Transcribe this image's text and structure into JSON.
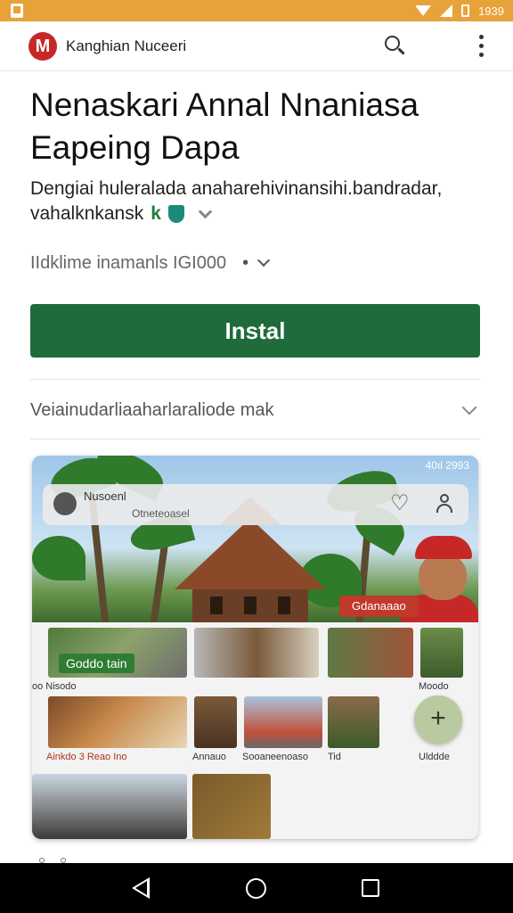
{
  "status_bar": {
    "time": "1939"
  },
  "app_bar": {
    "logo_letter": "M",
    "app_name": "Kanghian Nuceeri"
  },
  "listing": {
    "title": "Nenaskari Annal Nnaniasa Eapeing Dapa",
    "subtitle_line1": "Dengiai huleralada anaharehivinansihi.bandradar,",
    "subtitle_line2": "vahalknkansk",
    "subtitle_badge": "k",
    "meta_text": "IIdklime inamanls IGI000",
    "meta_dot": "•",
    "install_label": "Instal",
    "expand_label": "Veiainudarliaaharlaraliode mak"
  },
  "preview": {
    "inner_status": "40ıl 2993",
    "search_title": "Nusoenl",
    "search_sub": "Otneteoasel",
    "hero_chip": "Gdanaaao",
    "green_chip": "Goddo tain",
    "row1_label_left": "oo Nisodo",
    "row1_label_right": "Moodo",
    "row2_label1": "Ainkdo 3 Reao Ino",
    "row2_label2": "Annauo",
    "row2_label3": "Sooaneenoaso",
    "row2_label4": "Tid",
    "row2_label5": "Ulddde",
    "fab_symbol": "+"
  },
  "icons": {
    "search": "search-icon",
    "more": "more-vert-icon",
    "shield": "shield-icon",
    "back": "back-icon",
    "home": "home-icon",
    "recents": "recents-icon"
  },
  "colors": {
    "status_bar": "#e8a23a",
    "install_button": "#1f6b3c",
    "brand_red": "#c62828"
  }
}
